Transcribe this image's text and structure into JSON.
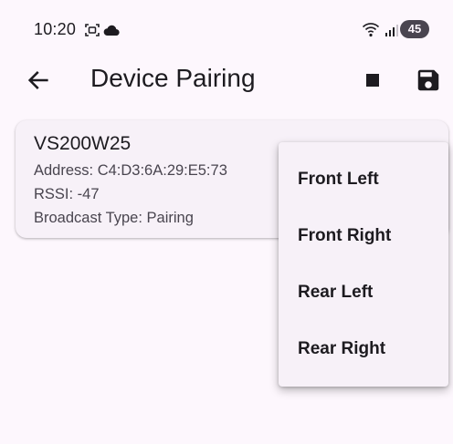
{
  "status_bar": {
    "time": "10:20",
    "battery_level": "45",
    "icons": [
      "screenshot-icon",
      "cloud-icon",
      "wifi-icon",
      "signal-icon",
      "battery-icon"
    ]
  },
  "app_bar": {
    "title": "Device Pairing",
    "icons": [
      "back-arrow-icon",
      "stop-icon",
      "save-icon"
    ]
  },
  "device": {
    "name": "VS200W25",
    "address": "Address: C4:D3:6A:29:E5:73",
    "rssi": "RSSI: -47",
    "broadcast_type": "Broadcast Type: Pairing"
  },
  "popup_menu": {
    "items": [
      {
        "label": "Front Left"
      },
      {
        "label": "Front Right"
      },
      {
        "label": "Rear Left"
      },
      {
        "label": "Rear Right"
      }
    ]
  },
  "colors": {
    "background": "#fdf7fd",
    "surface": "#f7f1f8",
    "text_primary": "#1d1b20",
    "text_secondary": "#49454f",
    "icon": "#1d1b20"
  }
}
